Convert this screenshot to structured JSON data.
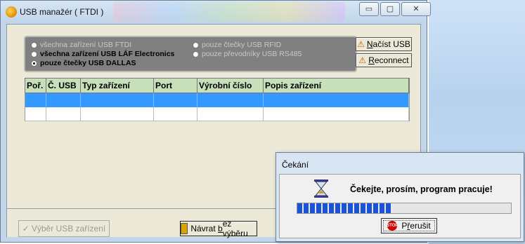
{
  "window": {
    "title": "USB manažér ( FTDI )",
    "caption_buttons": [
      "▭",
      "▢",
      "✕"
    ]
  },
  "options": {
    "radios": [
      {
        "label": "všechna zařízení USB FTDI",
        "state": "disabled"
      },
      {
        "label": "všechna zařízení USB LÁF Electronics",
        "state": "enabled"
      },
      {
        "label": "pouze čtečky USB DALLAS",
        "state": "checked"
      },
      {
        "label": "pouze čtečky USB RFID",
        "state": "disabled"
      },
      {
        "label": "pouze převodníky USB RS485",
        "state": "disabled"
      }
    ],
    "load_button": {
      "prefix": "N",
      "rest": "ačíst USB"
    },
    "reconnect_button": {
      "prefix": "R",
      "rest": "econnect"
    }
  },
  "table": {
    "headers": [
      "Poř.",
      "Č. USB",
      "Typ zařízení",
      "Port",
      "Výrobní číslo",
      "Popis zařízení"
    ]
  },
  "footer": {
    "select_label": "Výběr USB zařízení",
    "back_label_pre": "Návrat ",
    "back_label_u": "b",
    "back_label_post": "ez výběru"
  },
  "dialog": {
    "title": "Čekání",
    "message": "Čekejte, prosím, program pracuje!",
    "progress_fraction": 0.44,
    "stop_badge": "STOP",
    "stop_pre": "P",
    "stop_u": "ř",
    "stop_post": "erušit"
  },
  "colors": {
    "selected_row": "#3399ff",
    "header_bg": "#c7dfba",
    "progress": "#1a54d6"
  }
}
